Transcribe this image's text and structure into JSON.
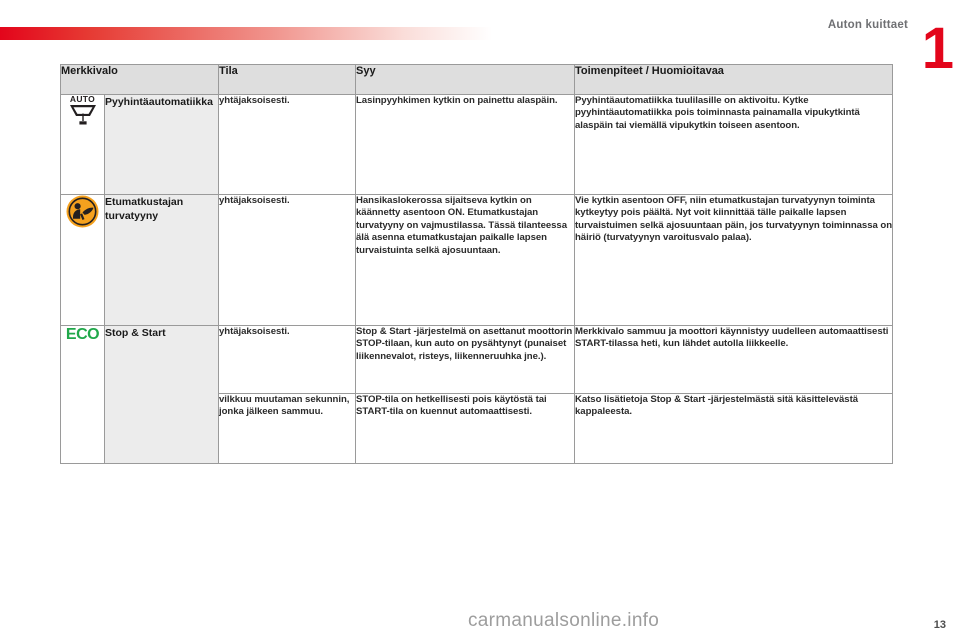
{
  "document": {
    "section_title": "Auton kuittaet",
    "chapter_number": "1",
    "page_number": "13",
    "watermark": "carmanualsonline.info"
  },
  "table": {
    "headers": {
      "indicator": "Merkkivalo",
      "state": "Tila",
      "cause": "Syy",
      "actions": "Toimenpiteet / Huomioitavaa"
    },
    "rows": [
      {
        "icon_name": "auto-wiper-icon",
        "icon_label": "AUTO",
        "name": "Pyyhintäautomatiikka",
        "state": "yhtäjaksoisesti.",
        "cause": "Lasinpyyhkimen kytkin on painettu alaspäin.",
        "actions": "Pyyhintäautomatiikka tuulilasille on aktivoitu. Kytke pyyhintäautomatiikka pois toiminnasta painamalla vipukytkintä alaspäin tai viemällä vipukytkin toiseen asentoon."
      },
      {
        "icon_name": "passenger-airbag-off-icon",
        "icon_label": "",
        "name": "Etumatkustajan turvatyyny",
        "state": "yhtäjaksoisesti.",
        "cause": "Hansikaslokerossa sijaitseva kytkin on käännetty asentoon ON. Etumatkustajan turvatyyny on vajmustilassa. Tässä tilanteessa älä asenna etumatkustajan paikalle lapsen turvaistuinta selkä ajosuuntaan.",
        "actions": "Vie kytkin asentoon OFF, niin etumatkustajan turvatyynyn toiminta kytkeytyy pois päältä. Nyt voit kiinnittää tälle paikalle lapsen turvaistuimen selkä ajosuuntaan päin, jos turvatyynyn toiminnassa on häiriö (turvatyynyn varoitusvalo palaa)."
      },
      {
        "icon_name": "eco-stop-start-icon",
        "icon_label": "ECO",
        "name": "Stop & Start",
        "state": "yhtäjaksoisesti.",
        "cause": "Stop & Start -järjestelmä on asettanut moottorin STOP-tilaan, kun auto on pysähtynyt (punaiset liikennevalot, risteys, liikenneruuhka jne.).",
        "actions": "Merkkivalo sammuu ja moottori käynnistyy uudelleen automaattisesti START-tilassa heti, kun lähdet autolla liikkeelle."
      },
      {
        "icon_name": "",
        "icon_label": "",
        "name": "",
        "state": "vilkkuu muutaman sekunnin, jonka jälkeen sammuu.",
        "cause": "STOP-tila on hetkellisesti pois käytöstä tai START-tila on kuennut automaattisesti.",
        "actions": "Katso lisätietoja Stop & Start -järjestelmästä sitä käsittelevästä kappaleesta."
      }
    ]
  }
}
